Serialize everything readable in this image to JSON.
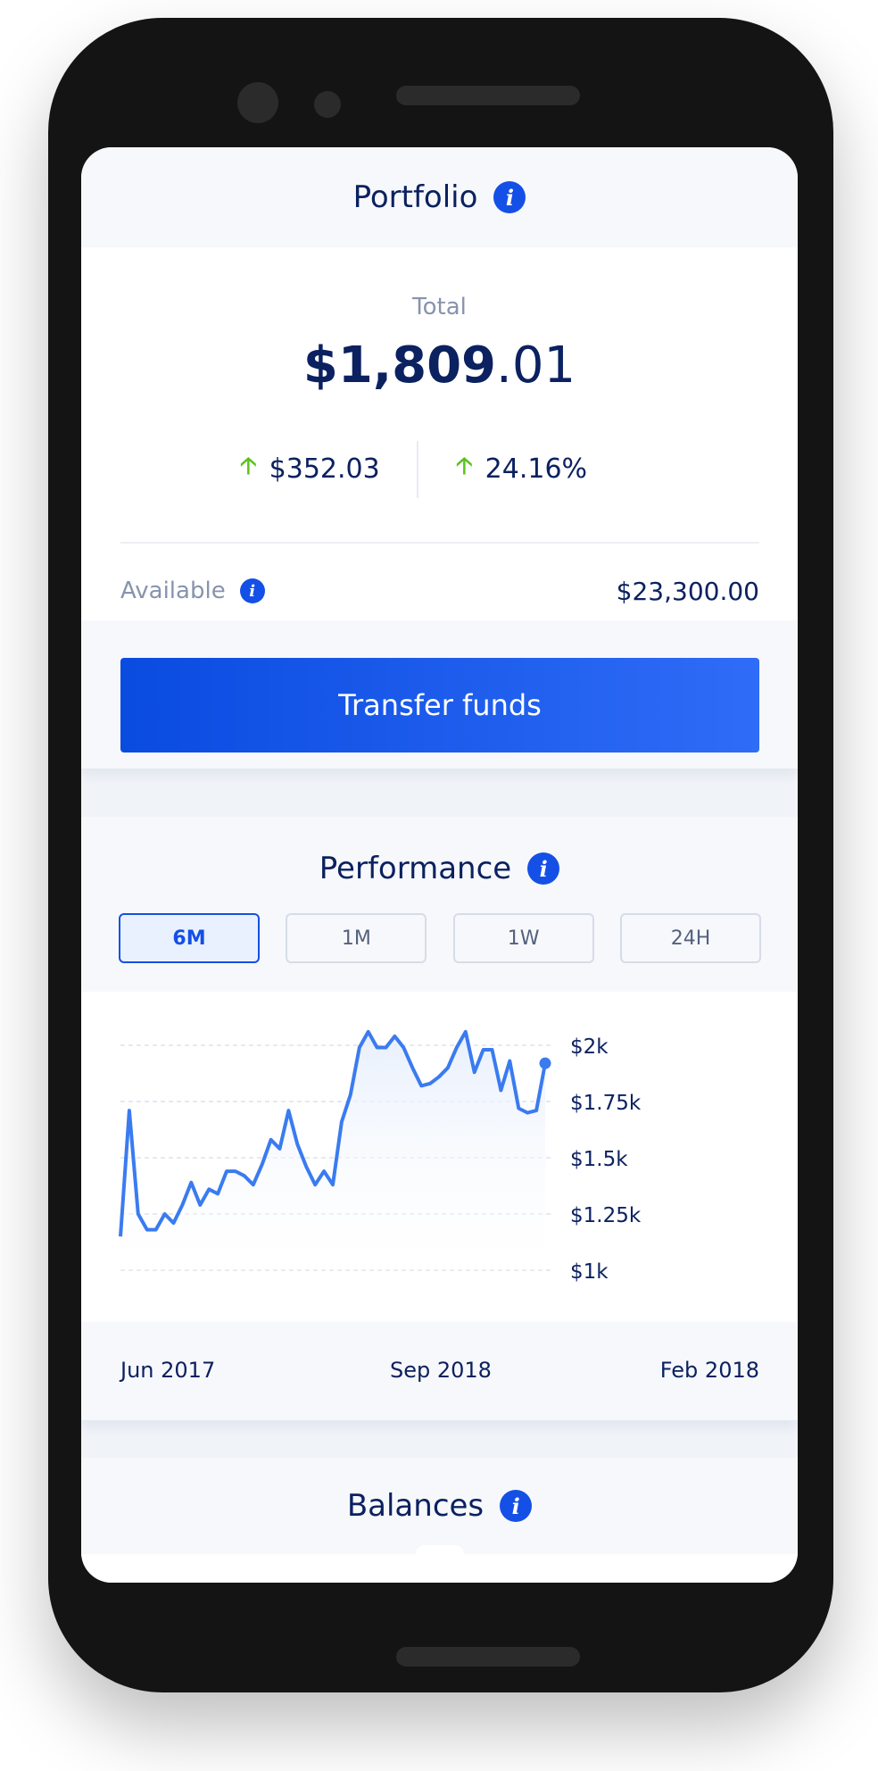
{
  "portfolio": {
    "title": "Portfolio",
    "info_glyph": "i",
    "total_label": "Total",
    "total_dollars": "$1,809",
    "total_cents": ".01",
    "change_amount": "$352.03",
    "change_percent": "24.16%",
    "change_direction": "up",
    "available_label": "Available",
    "available_value": "$23,300.00",
    "transfer_button": "Transfer funds"
  },
  "performance": {
    "title": "Performance",
    "tabs": [
      {
        "label": "6M",
        "active": true
      },
      {
        "label": "1M",
        "active": false
      },
      {
        "label": "1W",
        "active": false
      },
      {
        "label": "24H",
        "active": false
      }
    ],
    "x_labels": [
      "Jun 2017",
      "Sep 2018",
      "Feb 2018"
    ]
  },
  "balances": {
    "title": "Balances"
  },
  "colors": {
    "brand_blue": "#1450e6",
    "line_blue": "#3a7bf0",
    "positive_green": "#5bc21b",
    "text_navy": "#0b2160"
  },
  "icons": [
    "info-icon",
    "arrow-up-icon"
  ],
  "chart_data": {
    "type": "line",
    "ylim": [
      1000,
      2000
    ],
    "y_ticks": [
      "$2k",
      "$1.75k",
      "$1.5k",
      "$1.25k",
      "$1k"
    ],
    "y_tick_values": [
      2000,
      1750,
      1500,
      1250,
      1000
    ],
    "x_labels": [
      "Jun 2017",
      "Sep 2018",
      "Feb 2018"
    ],
    "grid": true,
    "series": [
      {
        "values": [
          1150,
          1710,
          1250,
          1180,
          1180,
          1250,
          1210,
          1290,
          1390,
          1290,
          1360,
          1340,
          1440,
          1440,
          1420,
          1380,
          1470,
          1580,
          1540,
          1710,
          1560,
          1460,
          1380,
          1440,
          1380,
          1660,
          1780,
          1990,
          2060,
          1990,
          1990,
          2040,
          1990,
          1900,
          1820,
          1830,
          1860,
          1900,
          1990,
          2060,
          1880,
          1980,
          1980,
          1800,
          1930,
          1720,
          1700,
          1710,
          1920
        ]
      }
    ]
  }
}
